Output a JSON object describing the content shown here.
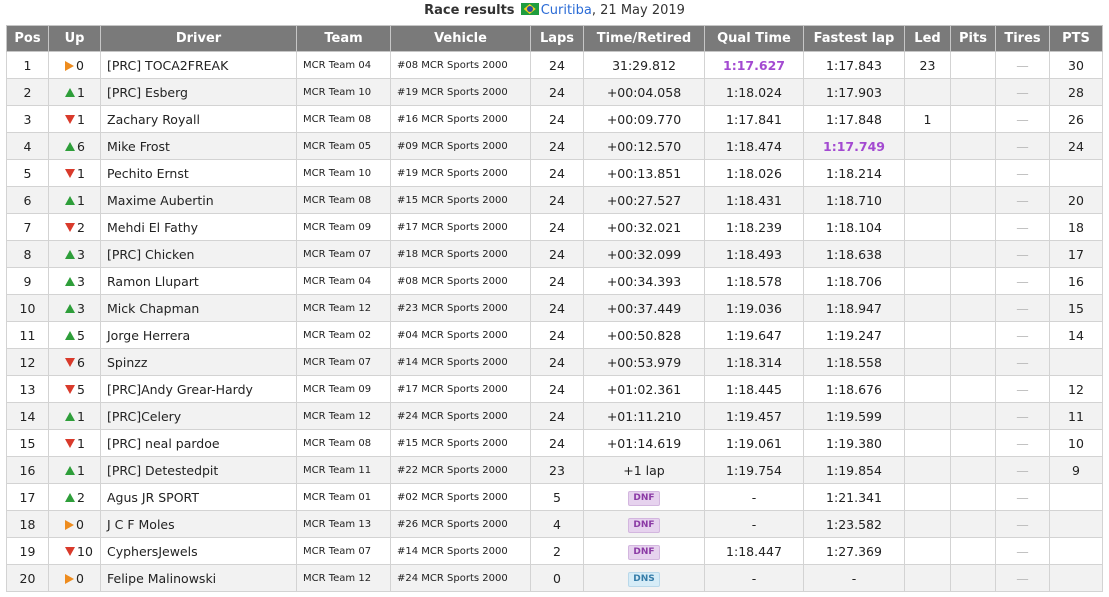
{
  "header": {
    "label": "Race results",
    "flag_icon": "brazil-flag-icon",
    "city": "Curitiba",
    "date": ", 21 May 2019"
  },
  "columns": [
    "Pos",
    "Up",
    "Driver",
    "Team",
    "Vehicle",
    "Laps",
    "Time/Retired",
    "Qual Time",
    "Fastest lap",
    "Led",
    "Pits",
    "Tires",
    "PTS"
  ],
  "colors": {
    "up": "#2e9e3a",
    "down": "#d93a2b",
    "same": "#ee8c1e",
    "best": "#a34ad1"
  },
  "rows": [
    {
      "pos": "1",
      "dir": "same",
      "up": "0",
      "driver": "[PRC] TOCA2FREAK",
      "team": "MCR Team 04",
      "vehicle": "#08 MCR Sports 2000",
      "laps": "24",
      "time": "31:29.812",
      "qual": "1:17.627",
      "qual_best": true,
      "fastest": "1:17.843",
      "fast_best": false,
      "led": "23",
      "pits": "",
      "tires": "—",
      "pts": "30"
    },
    {
      "pos": "2",
      "dir": "up",
      "up": "1",
      "driver": "[PRC] Esberg",
      "team": "MCR Team 10",
      "vehicle": "#19 MCR Sports 2000",
      "laps": "24",
      "time": "+00:04.058",
      "qual": "1:18.024",
      "fastest": "1:17.903",
      "led": "",
      "pits": "",
      "tires": "—",
      "pts": "28"
    },
    {
      "pos": "3",
      "dir": "down",
      "up": "1",
      "driver": "Zachary Royall",
      "team": "MCR Team 08",
      "vehicle": "#16 MCR Sports 2000",
      "laps": "24",
      "time": "+00:09.770",
      "qual": "1:17.841",
      "fastest": "1:17.848",
      "led": "1",
      "pits": "",
      "tires": "—",
      "pts": "26"
    },
    {
      "pos": "4",
      "dir": "up",
      "up": "6",
      "driver": "Mike Frost",
      "team": "MCR Team 05",
      "vehicle": "#09 MCR Sports 2000",
      "laps": "24",
      "time": "+00:12.570",
      "qual": "1:18.474",
      "fastest": "1:17.749",
      "fast_best": true,
      "led": "",
      "pits": "",
      "tires": "—",
      "pts": "24"
    },
    {
      "pos": "5",
      "dir": "down",
      "up": "1",
      "driver": "Pechito Ernst",
      "team": "MCR Team 10",
      "vehicle": "#19 MCR Sports 2000",
      "laps": "24",
      "time": "+00:13.851",
      "qual": "1:18.026",
      "fastest": "1:18.214",
      "led": "",
      "pits": "",
      "tires": "—",
      "pts": ""
    },
    {
      "pos": "6",
      "dir": "up",
      "up": "1",
      "driver": "Maxime Aubertin",
      "team": "MCR Team 08",
      "vehicle": "#15 MCR Sports 2000",
      "laps": "24",
      "time": "+00:27.527",
      "qual": "1:18.431",
      "fastest": "1:18.710",
      "led": "",
      "pits": "",
      "tires": "—",
      "pts": "20"
    },
    {
      "pos": "7",
      "dir": "down",
      "up": "2",
      "driver": "Mehdi El Fathy",
      "team": "MCR Team 09",
      "vehicle": "#17 MCR Sports 2000",
      "laps": "24",
      "time": "+00:32.021",
      "qual": "1:18.239",
      "fastest": "1:18.104",
      "led": "",
      "pits": "",
      "tires": "—",
      "pts": "18"
    },
    {
      "pos": "8",
      "dir": "up",
      "up": "3",
      "driver": "[PRC] Chicken",
      "team": "MCR Team 07",
      "vehicle": "#18 MCR Sports 2000",
      "laps": "24",
      "time": "+00:32.099",
      "qual": "1:18.493",
      "fastest": "1:18.638",
      "led": "",
      "pits": "",
      "tires": "—",
      "pts": "17"
    },
    {
      "pos": "9",
      "dir": "up",
      "up": "3",
      "driver": "Ramon Llupart",
      "team": "MCR Team 04",
      "vehicle": "#08 MCR Sports 2000",
      "laps": "24",
      "time": "+00:34.393",
      "qual": "1:18.578",
      "fastest": "1:18.706",
      "led": "",
      "pits": "",
      "tires": "—",
      "pts": "16"
    },
    {
      "pos": "10",
      "dir": "up",
      "up": "3",
      "driver": "Mick Chapman",
      "team": "MCR Team 12",
      "vehicle": "#23 MCR Sports 2000",
      "laps": "24",
      "time": "+00:37.449",
      "qual": "1:19.036",
      "fastest": "1:18.947",
      "led": "",
      "pits": "",
      "tires": "—",
      "pts": "15"
    },
    {
      "pos": "11",
      "dir": "up",
      "up": "5",
      "driver": "Jorge Herrera",
      "team": "MCR Team 02",
      "vehicle": "#04 MCR Sports 2000",
      "laps": "24",
      "time": "+00:50.828",
      "qual": "1:19.647",
      "fastest": "1:19.247",
      "led": "",
      "pits": "",
      "tires": "—",
      "pts": "14"
    },
    {
      "pos": "12",
      "dir": "down",
      "up": "6",
      "driver": "Spinzz",
      "team": "MCR Team 07",
      "vehicle": "#14 MCR Sports 2000",
      "laps": "24",
      "time": "+00:53.979",
      "qual": "1:18.314",
      "fastest": "1:18.558",
      "led": "",
      "pits": "",
      "tires": "—",
      "pts": ""
    },
    {
      "pos": "13",
      "dir": "down",
      "up": "5",
      "driver": "[PRC]Andy Grear-Hardy",
      "team": "MCR Team 09",
      "vehicle": "#17 MCR Sports 2000",
      "laps": "24",
      "time": "+01:02.361",
      "qual": "1:18.445",
      "fastest": "1:18.676",
      "led": "",
      "pits": "",
      "tires": "—",
      "pts": "12"
    },
    {
      "pos": "14",
      "dir": "up",
      "up": "1",
      "driver": "[PRC]Celery",
      "team": "MCR Team 12",
      "vehicle": "#24 MCR Sports 2000",
      "laps": "24",
      "time": "+01:11.210",
      "qual": "1:19.457",
      "fastest": "1:19.599",
      "led": "",
      "pits": "",
      "tires": "—",
      "pts": "11"
    },
    {
      "pos": "15",
      "dir": "down",
      "up": "1",
      "driver": "[PRC] neal pardoe",
      "team": "MCR Team 08",
      "vehicle": "#15 MCR Sports 2000",
      "laps": "24",
      "time": "+01:14.619",
      "qual": "1:19.061",
      "fastest": "1:19.380",
      "led": "",
      "pits": "",
      "tires": "—",
      "pts": "10"
    },
    {
      "pos": "16",
      "dir": "up",
      "up": "1",
      "driver": "[PRC] Detestedpit",
      "team": "MCR Team 11",
      "vehicle": "#22 MCR Sports 2000",
      "laps": "23",
      "time": "+1 lap",
      "qual": "1:19.754",
      "fastest": "1:19.854",
      "led": "",
      "pits": "",
      "tires": "—",
      "pts": "9"
    },
    {
      "pos": "17",
      "dir": "up",
      "up": "2",
      "driver": "Agus JR SPORT",
      "team": "MCR Team 01",
      "vehicle": "#02 MCR Sports 2000",
      "laps": "5",
      "time": "",
      "badge": "DNF",
      "qual": "-",
      "fastest": "1:21.341",
      "led": "",
      "pits": "",
      "tires": "—",
      "pts": ""
    },
    {
      "pos": "18",
      "dir": "same",
      "up": "0",
      "driver": "J C F Moles",
      "team": "MCR Team 13",
      "vehicle": "#26 MCR Sports 2000",
      "laps": "4",
      "time": "",
      "badge": "DNF",
      "qual": "-",
      "fastest": "1:23.582",
      "led": "",
      "pits": "",
      "tires": "—",
      "pts": ""
    },
    {
      "pos": "19",
      "dir": "down",
      "up": "10",
      "driver": "CyphersJewels",
      "team": "MCR Team 07",
      "vehicle": "#14 MCR Sports 2000",
      "laps": "2",
      "time": "",
      "badge": "DNF",
      "qual": "1:18.447",
      "fastest": "1:27.369",
      "led": "",
      "pits": "",
      "tires": "—",
      "pts": ""
    },
    {
      "pos": "20",
      "dir": "same",
      "up": "0",
      "driver": "Felipe Malinowski",
      "team": "MCR Team 12",
      "vehicle": "#24 MCR Sports 2000",
      "laps": "0",
      "time": "",
      "badge": "DNS",
      "qual": "-",
      "fastest": "-",
      "led": "",
      "pits": "",
      "tires": "—",
      "pts": ""
    }
  ]
}
